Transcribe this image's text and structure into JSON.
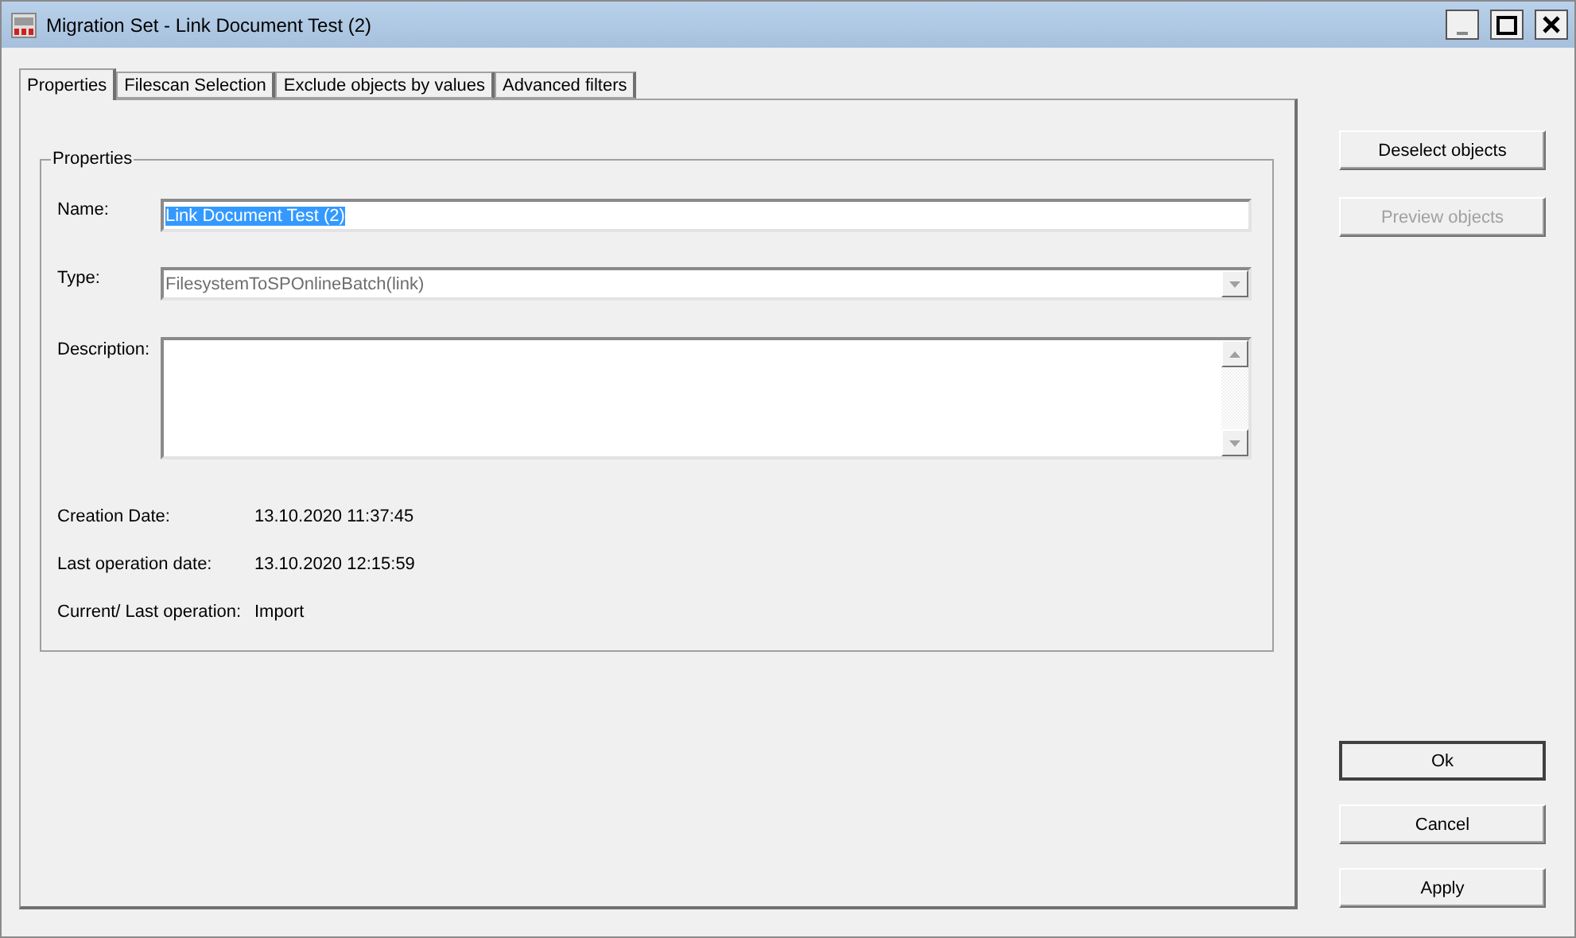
{
  "window": {
    "title": "Migration Set - Link Document Test (2)"
  },
  "tabs": [
    {
      "label": "Properties",
      "selected": true
    },
    {
      "label": "Filescan Selection",
      "selected": false
    },
    {
      "label": "Exclude objects by values",
      "selected": false
    },
    {
      "label": "Advanced filters",
      "selected": false
    }
  ],
  "group": {
    "title": "Properties"
  },
  "fields": [
    {
      "kind": "text",
      "label": "Name:",
      "value": "Link Document Test (2)",
      "highlighted": true
    },
    {
      "kind": "combo",
      "label": "Type:",
      "value": "FilesystemToSPOnlineBatch(link)",
      "disabled": true
    },
    {
      "kind": "memo",
      "label": "Description:"
    }
  ],
  "info": [
    {
      "label": "Creation Date:",
      "value": "13.10.2020 11:37:45"
    },
    {
      "label": "Last operation date:",
      "value": "13.10.2020 12:15:59"
    },
    {
      "label": "Current/ Last operation:",
      "value": "Import"
    }
  ],
  "side_buttons": [
    {
      "label": "Deselect objects",
      "disabled": false
    },
    {
      "label": "Preview objects",
      "disabled": true
    }
  ],
  "dialog_buttons": [
    {
      "label": "Ok",
      "default": true
    },
    {
      "label": "Cancel",
      "default": false
    },
    {
      "label": "Apply",
      "default": false
    }
  ]
}
